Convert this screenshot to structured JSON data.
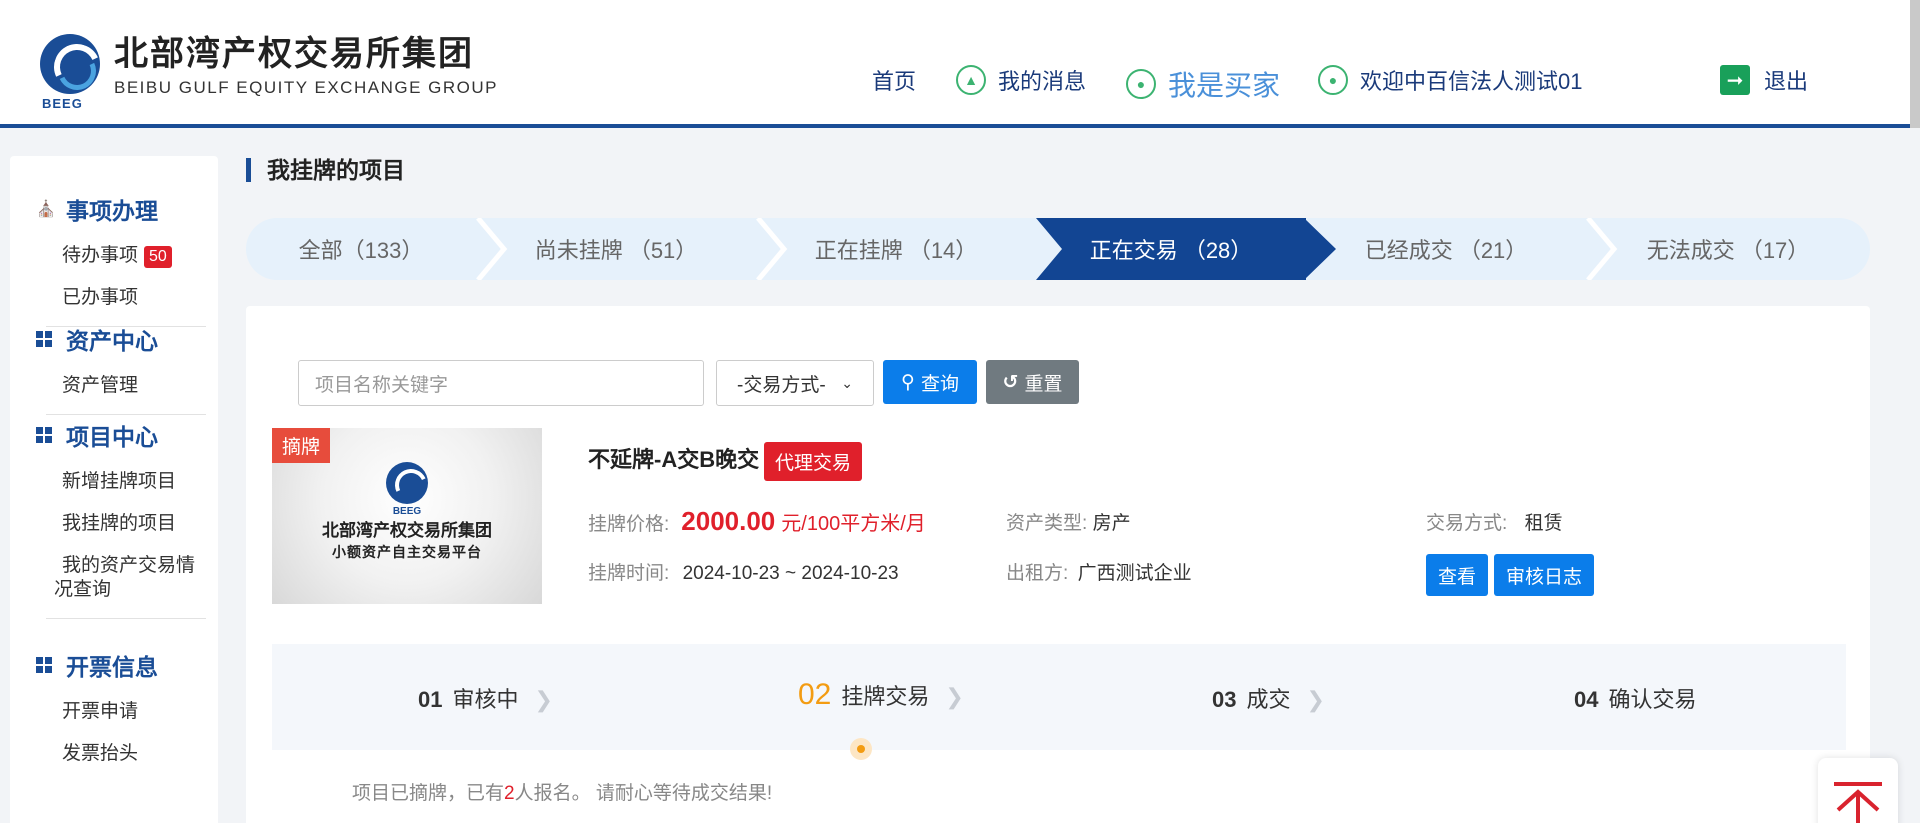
{
  "header": {
    "logo_cn": "北部湾产权交易所集团",
    "logo_en": "BEIBU GULF EQUITY EXCHANGE GROUP",
    "logo_abbr": "BEEG",
    "nav": {
      "home": "首页",
      "messages": "我的消息",
      "buyer": "我是买家",
      "welcome": "欢迎中百信法人测试01",
      "logout": "退出"
    }
  },
  "sidebar": {
    "sections": [
      {
        "title": "事项办理",
        "items": [
          {
            "label": "待办事项",
            "badge": "50"
          },
          {
            "label": "已办事项"
          }
        ]
      },
      {
        "title": "资产中心",
        "items": [
          {
            "label": "资产管理"
          }
        ]
      },
      {
        "title": "项目中心",
        "items": [
          {
            "label": "新增挂牌项目"
          },
          {
            "label": "我挂牌的项目"
          },
          {
            "label": "我的资产交易情况查询"
          }
        ]
      },
      {
        "title": "开票信息",
        "items": [
          {
            "label": "开票申请"
          },
          {
            "label": "发票抬头"
          }
        ]
      }
    ]
  },
  "main": {
    "title": "我挂牌的项目",
    "tabs": [
      {
        "label": "全部（133）"
      },
      {
        "label": "尚未挂牌 （51）"
      },
      {
        "label": "正在挂牌 （14）"
      },
      {
        "label": "正在交易 （28）",
        "active": true
      },
      {
        "label": "已经成交 （21）"
      },
      {
        "label": "无法成交 （17）"
      }
    ],
    "search": {
      "placeholder": "项目名称关键字",
      "select_value": "-交易方式-",
      "query_label": "查询",
      "reset_label": "重置"
    },
    "project": {
      "thumb_tag": "摘牌",
      "thumb_line1": "北部湾产权交易所集团",
      "thumb_line2": "小额资产自主交易平台",
      "thumb_abbr": "BEEG",
      "name": "不延牌-A交B晚交",
      "tag": "代理交易",
      "price_label": "挂牌价格:",
      "price": "2000.00",
      "price_unit": "元/100平方米/月",
      "time_label": "挂牌时间:",
      "time": "2024-10-23 ~ 2024-10-23",
      "asset_type_label": "资产类型:",
      "asset_type": "房产",
      "lessor_label": "出租方:",
      "lessor": "广西测试企业",
      "trade_mode_label": "交易方式:",
      "trade_mode": "租赁",
      "view_label": "查看",
      "log_label": "审核日志"
    },
    "steps": [
      {
        "num": "01",
        "label": "审核中"
      },
      {
        "num": "02",
        "label": "挂牌交易",
        "active": true
      },
      {
        "num": "03",
        "label": "成交"
      },
      {
        "num": "04",
        "label": "确认交易"
      }
    ],
    "notice": {
      "prefix": "项目已摘牌，已有",
      "count": "2",
      "suffix": "人报名。  请耐心等待成交结果!"
    }
  },
  "colors": {
    "brand": "#1a4d96",
    "active_tab": "#124593",
    "tab_bg": "#e6f1fb",
    "primary_button": "#0b7dea",
    "danger": "#e0202b",
    "step_active": "#f39c12"
  }
}
